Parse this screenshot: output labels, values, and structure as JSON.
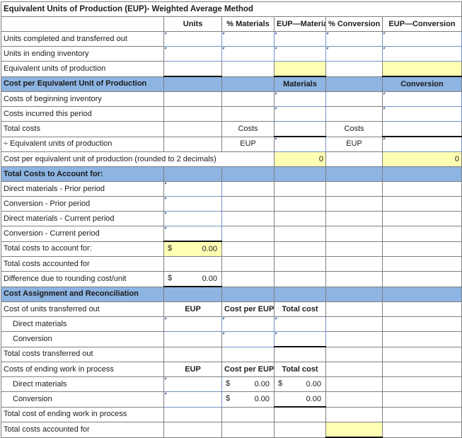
{
  "title": "Equivalent Units of Production (EUP)- Weighted Average Method",
  "columns": {
    "blank": "",
    "units": "Units",
    "pct_materials": "% Materials",
    "eup_materials": "EUP—Materials",
    "pct_conversion": "% Conversion",
    "eup_conversion": "EUP—Conversion"
  },
  "section_eup": {
    "rows": [
      {
        "label": "Units completed and transferred out"
      },
      {
        "label": "Units in ending inventory"
      },
      {
        "label": "Equivalent units of production"
      }
    ]
  },
  "section_cost_per_unit": {
    "header": "Cost per Equivalent Unit of Production",
    "header_materials": "Materials",
    "header_conversion": "Conversion",
    "rows": [
      {
        "label": "Costs of beginning inventory"
      },
      {
        "label": "Costs incurred this period"
      },
      {
        "label": "Total costs",
        "mat_tag": "Costs",
        "conv_tag": "Costs"
      },
      {
        "label": "÷ Equivalent units of production",
        "mat_tag": "EUP",
        "conv_tag": "EUP"
      },
      {
        "label": "Cost per equivalent unit of production (rounded to 2 decimals)",
        "mat_value": "0",
        "conv_value": "0"
      }
    ]
  },
  "section_total_costs": {
    "header": "Total Costs to Account for:",
    "rows": [
      {
        "label": "Direct materials - Prior period"
      },
      {
        "label": "Conversion - Prior period"
      },
      {
        "label": "Direct materials - Current period"
      },
      {
        "label": "Conversion - Current period"
      },
      {
        "label": "Total costs to account for:",
        "currency": "$",
        "value": "0.00"
      },
      {
        "label": "Total costs accounted for"
      },
      {
        "label": "Difference due to rounding cost/unit",
        "currency": "$",
        "value": "0.00"
      }
    ]
  },
  "section_assignment": {
    "header": "Cost Assignment and Reconciliation",
    "transferred_out": {
      "label": "Cost of units transferred out",
      "col_eup": "EUP",
      "col_cost_per_eup": "Cost per EUP",
      "col_total_cost": "Total cost",
      "rows": [
        {
          "label": "Direct materials"
        },
        {
          "label": "Conversion"
        }
      ],
      "total_label": "Total costs transferred out"
    },
    "ending_wip": {
      "label": "Costs of ending work in process",
      "col_eup": "EUP",
      "col_cost_per_eup": "Cost per EUP",
      "col_total_cost": "Total cost",
      "rows": [
        {
          "label": "Direct materials",
          "cost_per_eup_currency": "$",
          "cost_per_eup_value": "0.00",
          "total_currency": "$",
          "total_value": "0.00"
        },
        {
          "label": "Conversion",
          "cost_per_eup_currency": "$",
          "cost_per_eup_value": "0.00",
          "total_currency": "",
          "total_value": "0.00"
        }
      ],
      "total_label": "Total cost of ending work in process"
    },
    "grand_total_label": "Total costs accounted for"
  },
  "colors": {
    "header_blue": "#8DB4E2",
    "input_yellow": "#FFFFB3",
    "grid_line": "#808080",
    "input_border": "#7192C4"
  }
}
